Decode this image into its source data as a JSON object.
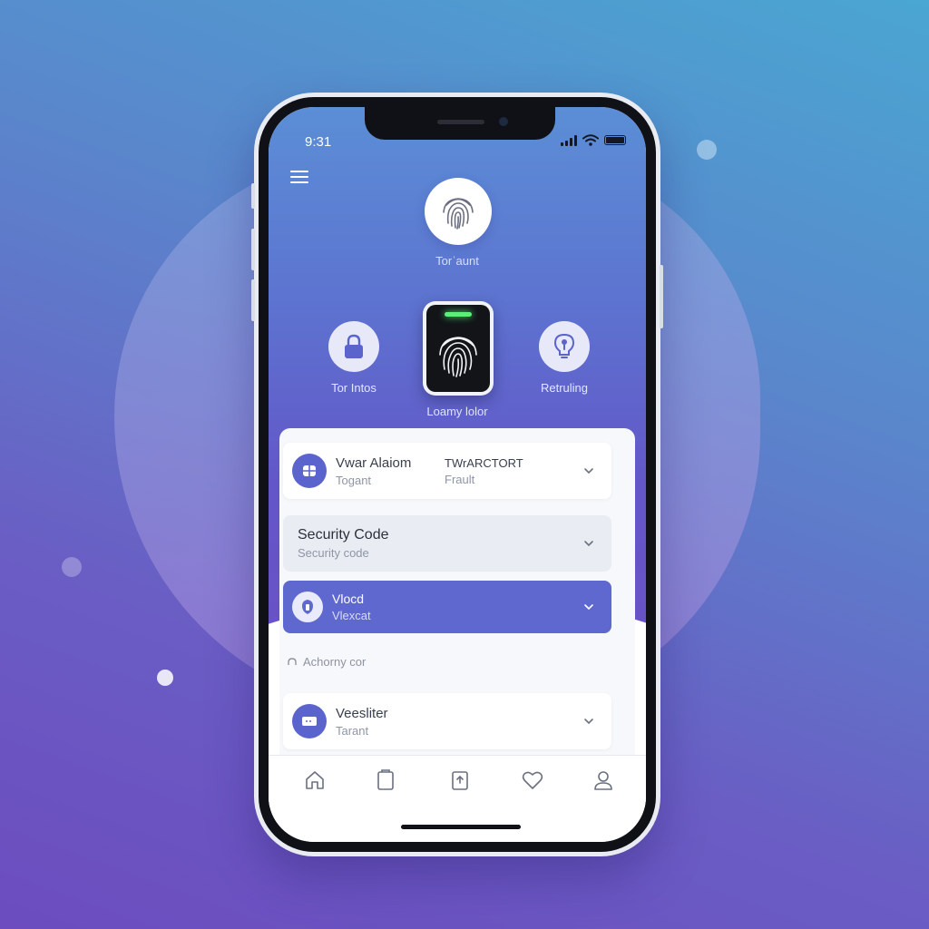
{
  "status_bar": {
    "time": "9:31"
  },
  "hero": {
    "top_fingerprint_label": "Torˈaunt",
    "left_button_label": "Tor Intos",
    "scanner_label": "Loamy lolor",
    "right_button_label": "Retruling"
  },
  "list": {
    "row1": {
      "title": "Vwar Alaiom",
      "subtitle": "Togant",
      "mid_title": "TWrARCTORT",
      "mid_subtitle": "Frault"
    },
    "row2": {
      "title": "Security Code",
      "subtitle": "Security code"
    },
    "row3": {
      "title": "Vlocd",
      "subtitle": "Vlexcat"
    },
    "section_caption": "Achorny cor",
    "row4": {
      "title": "Veesliter",
      "subtitle": "Tarant"
    }
  },
  "colors": {
    "accent": "#5b63cc",
    "selected_row": "#5f68cf",
    "scanner_led": "#5cf07a"
  },
  "icons": {
    "menu": "hamburger-icon",
    "tabs": [
      "home-icon",
      "document-icon",
      "upload-icon",
      "heart-icon",
      "profile-icon"
    ]
  }
}
